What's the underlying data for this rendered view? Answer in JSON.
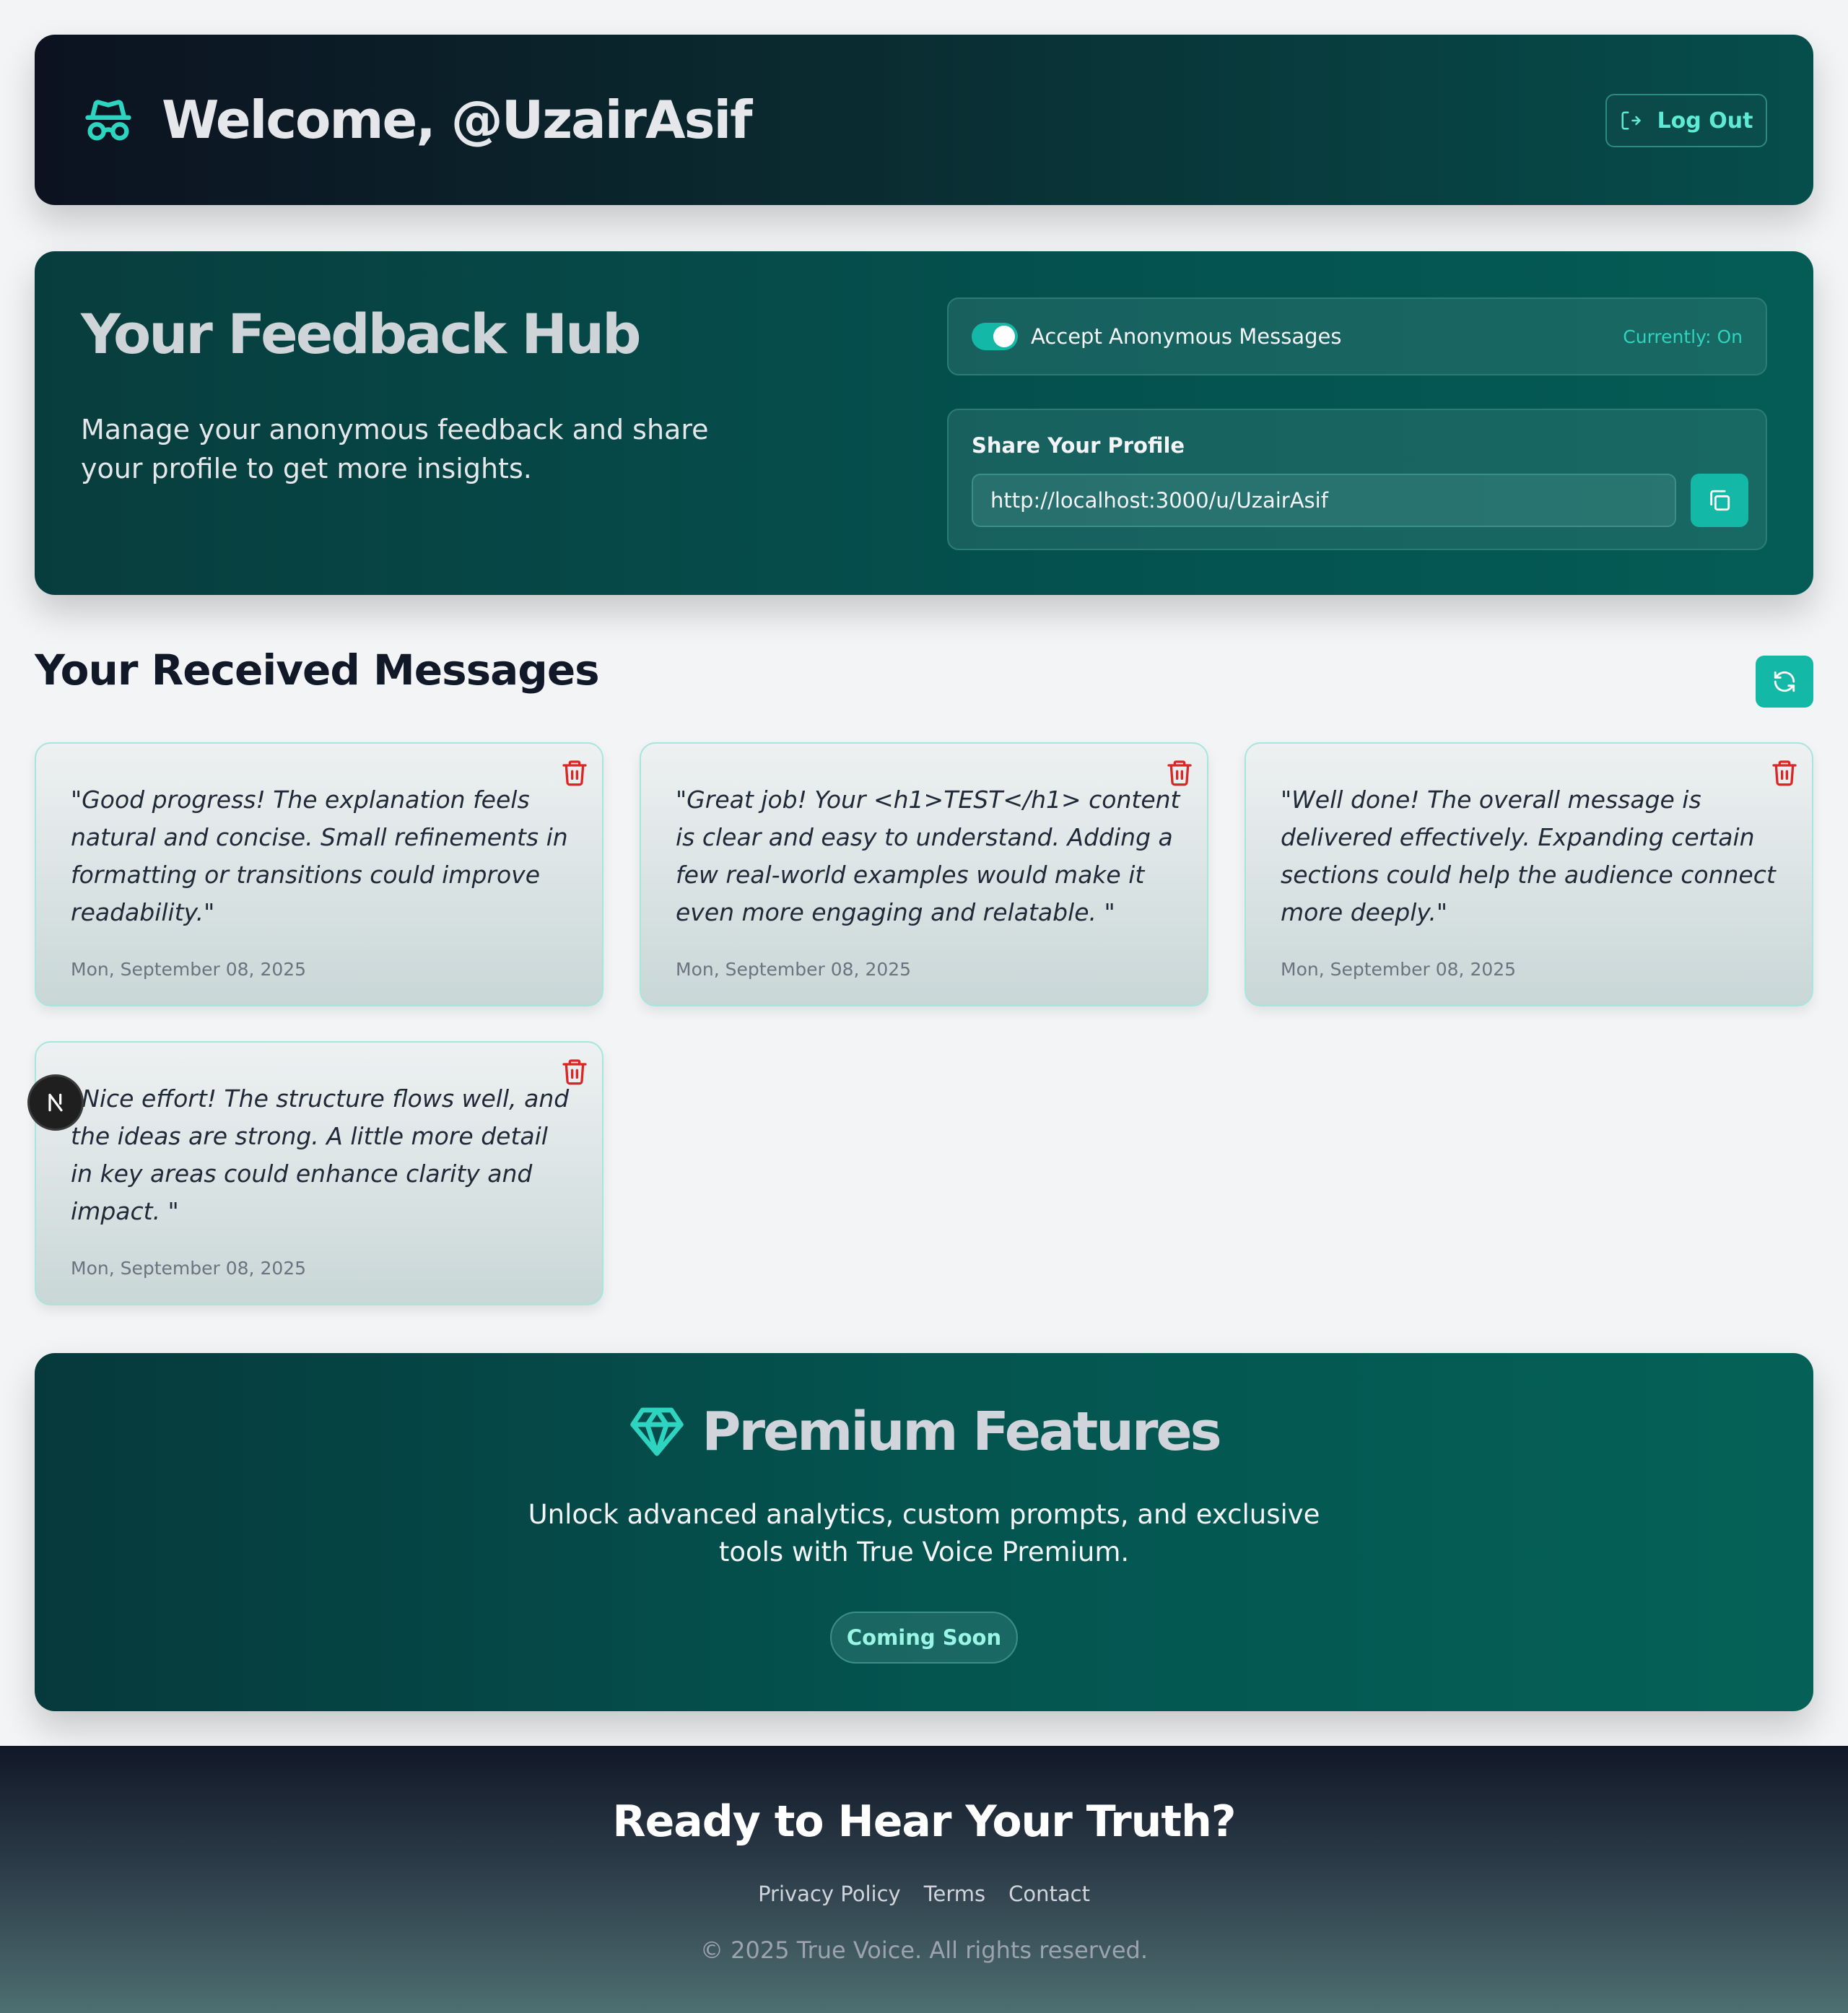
{
  "header": {
    "welcome": "Welcome, @UzairAsif",
    "logout_label": "Log Out"
  },
  "hub": {
    "title": "Your Feedback Hub",
    "subtitle": "Manage your anonymous feedback and share your profile to get more insights.",
    "toggle_label": "Accept Anonymous Messages",
    "toggle_on": true,
    "toggle_status": "Currently: On",
    "share_label": "Share Your Profile",
    "share_url": "http://localhost:3000/u/UzairAsif"
  },
  "messages": {
    "title": "Your Received Messages",
    "items": [
      {
        "text": "\"Good progress! The explanation feels natural and concise. Small refinements in formatting or transitions could improve readability.\"",
        "date": "Mon, September 08, 2025"
      },
      {
        "text": "\"Great job! Your <h1>TEST</h1> content is clear and easy to understand. Adding a few real-world examples would make it even more engaging and relatable. \"",
        "date": "Mon, September 08, 2025"
      },
      {
        "text": "\"Well done! The overall message is delivered effectively. Expanding certain sections could help the audience connect more deeply.\"",
        "date": "Mon, September 08, 2025"
      },
      {
        "text": "\"Nice effort! The structure flows well, and the ideas are strong. A little more detail in key areas could enhance clarity and impact. \"",
        "date": "Mon, September 08, 2025"
      }
    ]
  },
  "premium": {
    "title": "Premium Features",
    "subtitle": "Unlock advanced analytics, custom prompts, and exclusive tools with True Voice Premium.",
    "button_label": "Coming Soon"
  },
  "footer": {
    "title": "Ready to Hear Your Truth?",
    "links": [
      "Privacy Policy",
      "Terms",
      "Contact"
    ],
    "copyright": "© 2025 True Voice. All rights reserved."
  },
  "colors": {
    "accent": "#14b8a6",
    "accent_light": "#5eead4",
    "danger": "#dc2626",
    "dark": "#111827"
  },
  "icons": {
    "header": "incognito-icon",
    "logout": "logout-icon",
    "copy": "copy-icon",
    "refresh": "refresh-icon",
    "delete": "trash-icon",
    "premium": "gem-icon",
    "dev_badge": "nextjs-icon"
  }
}
